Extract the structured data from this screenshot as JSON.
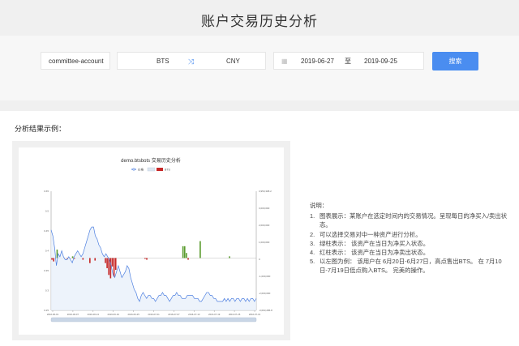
{
  "page": {
    "title": "账户交易历史分析"
  },
  "search": {
    "account": "committee-account",
    "base_asset": "BTS",
    "quote_asset": "CNY",
    "start_date": "2019-06-27",
    "date_sep": "至",
    "end_date": "2019-09-25",
    "button": "搜索"
  },
  "result": {
    "heading": "分析结果示例："
  },
  "chart_data": {
    "type": "bar",
    "title": "demo.btsbots 交易历史分析",
    "series": [
      {
        "name": "价格",
        "type": "line",
        "color": "#4d7fe0"
      },
      {
        "name": "BTS",
        "type": "bar",
        "color_positive": "#5a9b2e",
        "color_negative": "#c62828"
      }
    ],
    "legend": [
      "价格",
      "BTS"
    ],
    "x_tick_labels": [
      "2016-06-01",
      "2016-06-07",
      "2016-06-13",
      "2016-06-19",
      "2016-06-25",
      "2016-07-01",
      "2016-07-07",
      "2016-07-13",
      "2016-07-19",
      "2016-07-25",
      "2016-07-31"
    ],
    "y_left_ticks": [
      "0.65",
      "0.5",
      "0.45",
      "0.4",
      "0.35",
      "0.3",
      "0.25"
    ],
    "y_right_ticks": [
      "3,950,308.2",
      "3,000,000",
      "2,000,000",
      "1,000,000",
      "0",
      "-1,000,000",
      "-2,000,000",
      "-3,093,286.8"
    ],
    "ylim_left": [
      0.25,
      0.65
    ],
    "ylim_right": [
      -3093286.8,
      3950308.2
    ],
    "bts_values": [
      -100000,
      -200000,
      0,
      500000,
      0,
      0,
      0,
      0,
      0,
      -50000,
      0,
      0,
      100000,
      -50000,
      0,
      0,
      0,
      0,
      -100000,
      0,
      0,
      0,
      -300000,
      0,
      0,
      -150000,
      0,
      0,
      0,
      0,
      0,
      -300000,
      -600000,
      -1000000,
      -1200000,
      -500000,
      -1100000,
      -700000,
      0,
      0,
      0,
      0,
      0,
      0,
      0,
      0,
      0,
      0,
      0,
      0,
      0,
      0,
      0,
      0,
      -50000,
      -100000,
      0,
      0,
      0,
      0,
      0,
      0,
      0,
      0,
      0,
      0,
      0,
      0,
      0,
      0,
      0,
      0,
      0,
      0,
      0,
      0,
      700000,
      700000,
      300000,
      -100000,
      0,
      0,
      0,
      0,
      0,
      0,
      1000000,
      0,
      0,
      0,
      0,
      0,
      0,
      0,
      0,
      0,
      0,
      0,
      0,
      0,
      0,
      0,
      0,
      100000,
      0,
      0,
      0,
      0,
      0,
      0,
      0,
      0,
      0,
      0,
      0,
      0,
      0,
      0,
      0
    ],
    "price_values": [
      0.52,
      0.5,
      0.46,
      0.4,
      0.44,
      0.43,
      0.45,
      0.43,
      0.42,
      0.42,
      0.43,
      0.42,
      0.41,
      0.43,
      0.44,
      0.45,
      0.44,
      0.43,
      0.44,
      0.46,
      0.48,
      0.5,
      0.52,
      0.53,
      0.53,
      0.5,
      0.49,
      0.47,
      0.46,
      0.44,
      0.43,
      0.44,
      0.43,
      0.42,
      0.4,
      0.37,
      0.36,
      0.38,
      0.4,
      0.38,
      0.36,
      0.37,
      0.38,
      0.4,
      0.39,
      0.36,
      0.34,
      0.32,
      0.31,
      0.29,
      0.28,
      0.3,
      0.31,
      0.3,
      0.29,
      0.3,
      0.3,
      0.29,
      0.29,
      0.28,
      0.29,
      0.3,
      0.3,
      0.31,
      0.3,
      0.3,
      0.29,
      0.28,
      0.29,
      0.3,
      0.3,
      0.31,
      0.3,
      0.3,
      0.29,
      0.29,
      0.29,
      0.3,
      0.3,
      0.3,
      0.3,
      0.29,
      0.29,
      0.29,
      0.28,
      0.28,
      0.29,
      0.3,
      0.31,
      0.31,
      0.3,
      0.3,
      0.29,
      0.29,
      0.28,
      0.28,
      0.28,
      0.28,
      0.29,
      0.28,
      0.29,
      0.28,
      0.29,
      0.29,
      0.28,
      0.29,
      0.29,
      0.28,
      0.29,
      0.29,
      0.28,
      0.29,
      0.28,
      0.29,
      0.29,
      0.28,
      0.29
    ]
  },
  "notes": {
    "label": "说明：",
    "items": [
      {
        "num": "1.",
        "text": "图表展示：某账户在选定时间内的交易情况。呈现每日的净买入/卖出状态。"
      },
      {
        "num": "2.",
        "text": "可以选择交易对中一种资产进行分析。"
      },
      {
        "num": "3.",
        "text": "绿柱表示：  该资产在当日为净买入状态。"
      },
      {
        "num": "4.",
        "text": "红柱表示：  该资产在当日为净卖出状态。"
      },
      {
        "num": "5.",
        "text": "以左图为例：  该用户在 6月20日-6月27日，高点售出BTS。 在 7月10日-7月19日低点购入BTS。 完美的操作。"
      }
    ]
  },
  "icons": {
    "swap": "⤨",
    "calendar": "▦"
  },
  "colors": {
    "accent": "#4a8df0",
    "buy": "#5a9b2e",
    "sell": "#c62828",
    "price": "#4d7fe0"
  }
}
